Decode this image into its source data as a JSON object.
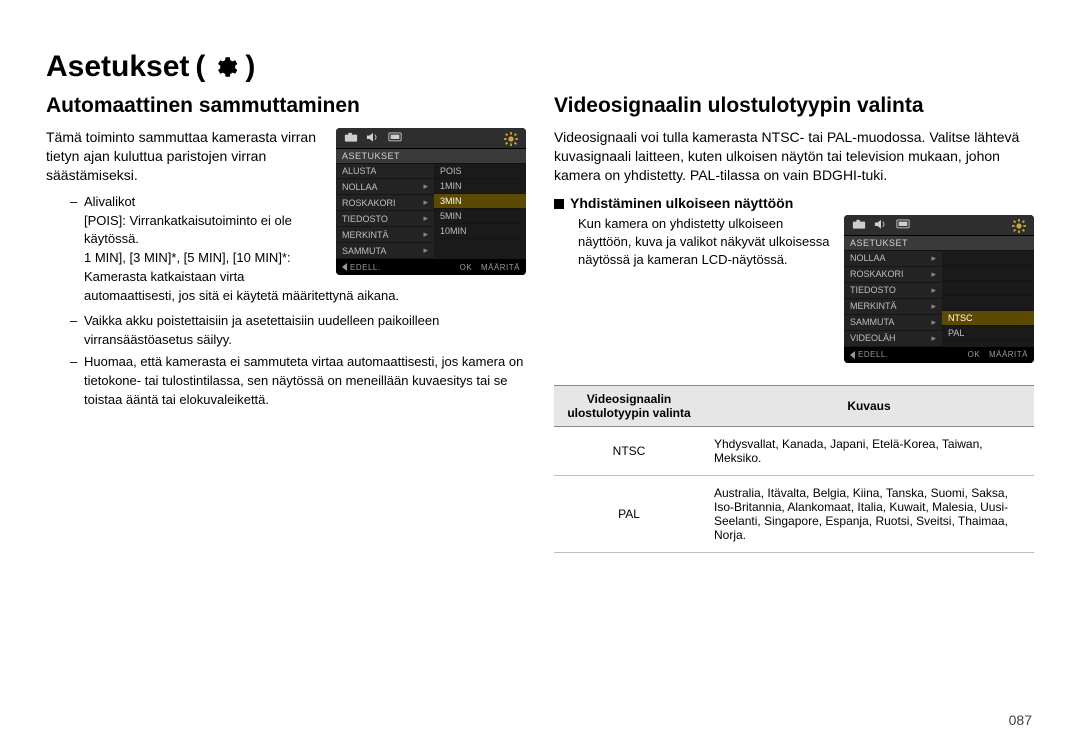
{
  "page_title": "Asetukset",
  "page_number": "087",
  "left": {
    "heading": "Automaattinen sammuttaminen",
    "intro": "Tämä toiminto sammuttaa kamerasta virran tietyn ajan kuluttua paristojen virran säästämiseksi.",
    "sub_label": "Alivalikot",
    "opt_pois_key": "[POIS]:",
    "opt_pois_val": "Virrankatkaisutoiminto ei ole käytössä.",
    "opt_times": "1 MIN], [3 MIN]*, [5 MIN], [10 MIN]*:",
    "opt_times_desc": "Kamerasta katkaistaan virta automaattisesti, jos sitä ei käytetä määritettynä aikana.",
    "note1": "Vaikka akku poistettaisiin ja asetettaisiin uudelleen paikoilleen virransäästöasetus säilyy.",
    "note2": "Huomaa, että kamerasta ei sammuteta virtaa automaattisesti, jos kamera on tietokone- tai tulostintilassa, sen näytössä on meneillään kuvaesitys tai se toistaa ääntä tai elokuvaleikettä.",
    "lcd": {
      "title": "ASETUKSET",
      "left_items": [
        "ALUSTA",
        "NOLLAA",
        "ROSKAKORI",
        "TIEDOSTO",
        "MERKINTÄ",
        "SAMMUTA"
      ],
      "right_items": [
        "POIS",
        "1MIN",
        "3MIN",
        "5MIN",
        "10MIN"
      ],
      "right_sel_index": 2,
      "bot_back": "EDELL.",
      "bot_ok": "OK",
      "bot_set": "MÄÄRITÄ"
    }
  },
  "right": {
    "heading": "Videosignaalin ulostulotyypin valinta",
    "intro": "Videosignaali voi tulla kamerasta NTSC- tai PAL-muodossa. Valitse lähtevä kuvasignaali laitteen, kuten ulkoisen näytön tai television mukaan, johon kamera on yhdistetty. PAL-tilassa on vain BDGHI-tuki.",
    "sub_heading": "Yhdistäminen ulkoiseen näyttöön",
    "sub_text": "Kun kamera on yhdistetty ulkoiseen näyttöön, kuva ja valikot näkyvät ulkoisessa näytössä ja kameran LCD-näytössä.",
    "lcd": {
      "title": "ASETUKSET",
      "left_items": [
        "NOLLAA",
        "ROSKAKORI",
        "TIEDOSTO",
        "MERKINTÄ",
        "SAMMUTA",
        "VIDEOLÄH"
      ],
      "right_items": [
        "NTSC",
        "PAL"
      ],
      "right_sel_index": 0,
      "bot_back": "EDELL.",
      "bot_ok": "OK",
      "bot_set": "MÄÄRITÄ"
    },
    "table": {
      "col1": "Videosignaalin ulostulotyypin valinta",
      "col2": "Kuvaus",
      "rows": [
        {
          "k": "NTSC",
          "v": "Yhdysvallat, Kanada, Japani, Etelä-Korea, Taiwan, Meksiko."
        },
        {
          "k": "PAL",
          "v": "Australia, Itävalta, Belgia, Kiina, Tanska, Suomi, Saksa, Iso-Britannia, Alankomaat, Italia, Kuwait, Malesia, Uusi-Seelanti, Singapore, Espanja, Ruotsi, Sveitsi, Thaimaa, Norja."
        }
      ]
    }
  }
}
